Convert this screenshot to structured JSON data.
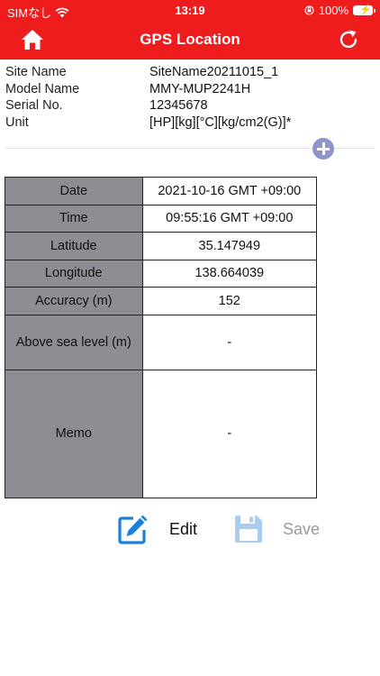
{
  "status_bar": {
    "carrier": "SIMなし",
    "time": "13:19",
    "battery": "100%"
  },
  "nav": {
    "title": "GPS Location",
    "color": "#ee1c1c"
  },
  "info": [
    {
      "label": "Site Name",
      "value": "SiteName20211015_1"
    },
    {
      "label": "Model Name",
      "value": "MMY-MUP2241H"
    },
    {
      "label": "Serial No.",
      "value": "12345678"
    },
    {
      "label": "Unit",
      "value": "[HP][kg][°C][kg/cm2(G)]*"
    }
  ],
  "table": [
    {
      "key": "Date",
      "value": "2021-10-16 GMT +09:00"
    },
    {
      "key": "Time",
      "value": "09:55:16 GMT +09:00"
    },
    {
      "key": "Latitude",
      "value": "35.147949"
    },
    {
      "key": "Longitude",
      "value": "138.664039"
    },
    {
      "key": "Accuracy (m)",
      "value": "152"
    },
    {
      "key": "Above sea level (m)",
      "value": "-"
    },
    {
      "key": "Memo",
      "value": "-"
    }
  ],
  "actions": {
    "edit_label": "Edit",
    "save_label": "Save",
    "edit_color": "#1e7fd6",
    "save_color": "#a9cdf0"
  },
  "icons": [
    "wifi-icon",
    "home-icon",
    "refresh-icon",
    "add-icon",
    "edit-icon",
    "save-icon",
    "battery-icon",
    "orientation-lock-icon"
  ]
}
